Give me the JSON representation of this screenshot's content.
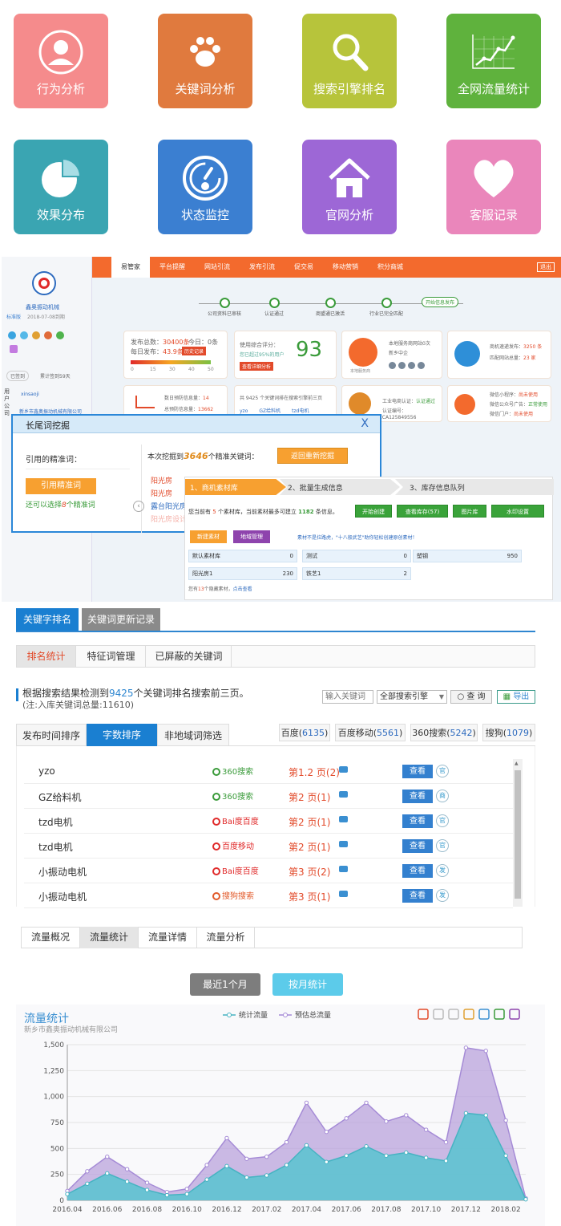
{
  "tiles": [
    {
      "label": "行为分析",
      "icon": "user-icon",
      "color": "#f58b8c"
    },
    {
      "label": "关键词分析",
      "icon": "paw-icon",
      "color": "#e07a3e"
    },
    {
      "label": "搜索引擎排名",
      "icon": "search-icon",
      "color": "#b7c43b"
    },
    {
      "label": "全网流量统计",
      "icon": "line-chart-icon",
      "color": "#5fb23d"
    },
    {
      "label": "效果分布",
      "icon": "pie-chart-icon",
      "color": "#3aa5b2"
    },
    {
      "label": "状态监控",
      "icon": "gauge-icon",
      "color": "#3b7fd1"
    },
    {
      "label": "官网分析",
      "icon": "home-icon",
      "color": "#9d67d6"
    },
    {
      "label": "客服记录",
      "icon": "heart-icon",
      "color": "#ea86bb"
    }
  ],
  "dash": {
    "nav": [
      "易管家",
      "平台提醒",
      "网站引流",
      "发布引流",
      "促交易",
      "移动营销",
      "积分商城"
    ],
    "exit": "退出",
    "company": "鑫奥振动机械",
    "edition": "标准版",
    "expire": "2018-07-08到期",
    "status_open": "已签到",
    "status_days": "累计签到59天",
    "steps": [
      "公司资料已审核",
      "认证通过",
      "商盟通已激活",
      "行业已完全匹配",
      "开始信息发布"
    ],
    "pub_total_lbl": "发布总数：",
    "pub_total": "30400条",
    "pub_today_lbl": "今日：",
    "pub_today": "0条",
    "pub_daily_lbl": "每日发布：",
    "pub_daily": "43.9条",
    "history": "历史记录",
    "scale": [
      "0",
      "15",
      "30",
      "40",
      "50"
    ],
    "score_lbl": "使用综合评分：",
    "score_sub": "您已超过95%的用户",
    "score": "93",
    "score_btn": "查看详细分析",
    "svc_title": "本地服务商网站0次",
    "svc_city": "新乡中企",
    "svc_icon": "本地服务商",
    "data_speed_lbl": "商机速递发布：",
    "data_speed": "3250 条",
    "data_match_lbl": "匹配网站总量：",
    "data_match": "23 家",
    "warn_lbl": "数日预防信息量：",
    "warn": "14",
    "read_lbl": "总预防信息量：",
    "read": "13662",
    "kw_note": "共 9425 个关键词排在搜索引擎前三页",
    "kw_list": [
      "yzo",
      "GZ给料机",
      "tzd电机"
    ],
    "cert_lbl": "工业电商认证：",
    "cert": "认证通过",
    "cert_no_lbl": "认证编号：",
    "cert_no": "ECA125849556",
    "wx1": "微信小程序：",
    "wx1v": "尚未使用",
    "wx2": "微信公众号广告：",
    "wx2v": "正常使用",
    "wx3": "微信门户：",
    "wx3v": "尚未使用",
    "side_user": "xinsaoji",
    "side_co": "新乡市鑫奥振动机械有限公司",
    "side_lbl": "用户公司"
  },
  "longtail": {
    "title": "长尾词挖掘",
    "close": "X",
    "cited_lbl": "引用的精准词：",
    "cite_btn": "引用精准词",
    "choose_pre": "还可以选择",
    "choose_n": "8",
    "choose_post": "个精准词",
    "found_pre": "本次挖掘到",
    "found_n": "3646",
    "found_post": "个精准关键词：",
    "rerun": "返回重新挖掘",
    "words": [
      "阳光房",
      "阳光房",
      "露台阳光房",
      "阳光房设计"
    ]
  },
  "material": {
    "steps": [
      "1、商机素材库",
      "2、批量生成信息",
      "3、库存信息队列"
    ],
    "info_pre": "您当前有",
    "info_n1": "5",
    "info_mid": "个素材库，当前素材最多可建立",
    "info_n2": "1182",
    "info_post": "条信息。",
    "btns": [
      "开始创建",
      "查看库存(57)",
      "图片库",
      "水印设置"
    ],
    "new_btn": "新建素材",
    "region_btn": "地域管理",
    "tip": "素材不是拉路虎，\"十八般武艺\"助你轻松创建原创素材！",
    "cells": [
      [
        "默认素材库",
        "0"
      ],
      [
        "测试",
        "0"
      ],
      [
        "塑钢",
        "950"
      ],
      [
        "阳光房1",
        "230"
      ],
      [
        "铁艺1",
        "2"
      ]
    ],
    "hidden_pre": "您有",
    "hidden_n": "13",
    "hidden_post": "个隐藏素材，",
    "hidden_link": "点击查看"
  },
  "ranking": {
    "tabs": [
      "关键字排名",
      "关键词更新记录"
    ],
    "subtabs": [
      "排名统计",
      "特征词管理",
      "已屏蔽的关键词"
    ],
    "summary_pre": "根据搜索结果检测到",
    "summary_n": "9425",
    "summary_post": "个关键词排名搜索前三页。",
    "summary_sub": "(注:入库关键词总量:11610)",
    "search_placeholder": "输入关键词",
    "engine_select": "全部搜索引擎",
    "query_btn": "查 询",
    "export_btn": "导出",
    "sort_tabs": [
      "发布时间排序",
      "字数排序",
      "非地域词筛选"
    ],
    "engine_tabs": [
      {
        "name": "百度",
        "n": "6135"
      },
      {
        "name": "百度移动",
        "n": "5561"
      },
      {
        "name": "360搜索",
        "n": "5242"
      },
      {
        "name": "搜狗",
        "n": "1079"
      }
    ],
    "rows": [
      {
        "kw": "yzo",
        "engine": "360搜索",
        "page": "第1.2 页(2)",
        "view": "查看",
        "badge": "官"
      },
      {
        "kw": "GZ给料机",
        "engine": "360搜索",
        "page": "第2 页(1)",
        "view": "查看",
        "badge": "商"
      },
      {
        "kw": "tzd电机",
        "engine": "Bai度百度",
        "page": "第2 页(1)",
        "view": "查看",
        "badge": "官"
      },
      {
        "kw": "tzd电机",
        "engine": "百度移动",
        "page": "第2 页(1)",
        "view": "查看",
        "badge": "官"
      },
      {
        "kw": "小振动电机",
        "engine": "Bai度百度",
        "page": "第3 页(2)",
        "view": "查看",
        "badge": "发"
      },
      {
        "kw": "小振动电机",
        "engine": "搜狗搜索",
        "page": "第3 页(1)",
        "view": "查看",
        "badge": "发"
      }
    ]
  },
  "traffic": {
    "tabs": [
      "流量概况",
      "流量统计",
      "流量详情",
      "流量分析"
    ],
    "btn1": "最近1个月",
    "btn2": "按月统计"
  },
  "chart_data": {
    "type": "area",
    "title": "流量统计",
    "subtitle": "新乡市鑫奥振动机械有限公司",
    "legend": [
      "统计流量",
      "预估总流量"
    ],
    "legend_position": "top-center",
    "ylim": [
      0,
      1500
    ],
    "yticks": [
      "0",
      "250",
      "500",
      "750",
      "1,000",
      "1,250",
      "1,500"
    ],
    "xticks": [
      "2016.04",
      "2016.06",
      "2016.08",
      "2016.10",
      "2016.12",
      "2017.02",
      "2017.04",
      "2017.06",
      "2017.08",
      "2017.10",
      "2017.12",
      "2018.02"
    ],
    "x_count": 24,
    "series": [
      {
        "name": "统计流量",
        "color": "#5ec3d0",
        "values": [
          60,
          160,
          260,
          180,
          100,
          50,
          60,
          200,
          330,
          220,
          240,
          340,
          530,
          370,
          430,
          520,
          430,
          460,
          410,
          380,
          840,
          820,
          430,
          10
        ]
      },
      {
        "name": "预估总流量",
        "color": "#b9a3dc",
        "values": [
          90,
          280,
          420,
          300,
          170,
          80,
          110,
          340,
          600,
          400,
          420,
          560,
          940,
          660,
          790,
          940,
          760,
          820,
          680,
          560,
          1470,
          1440,
          770,
          20
        ]
      }
    ]
  }
}
